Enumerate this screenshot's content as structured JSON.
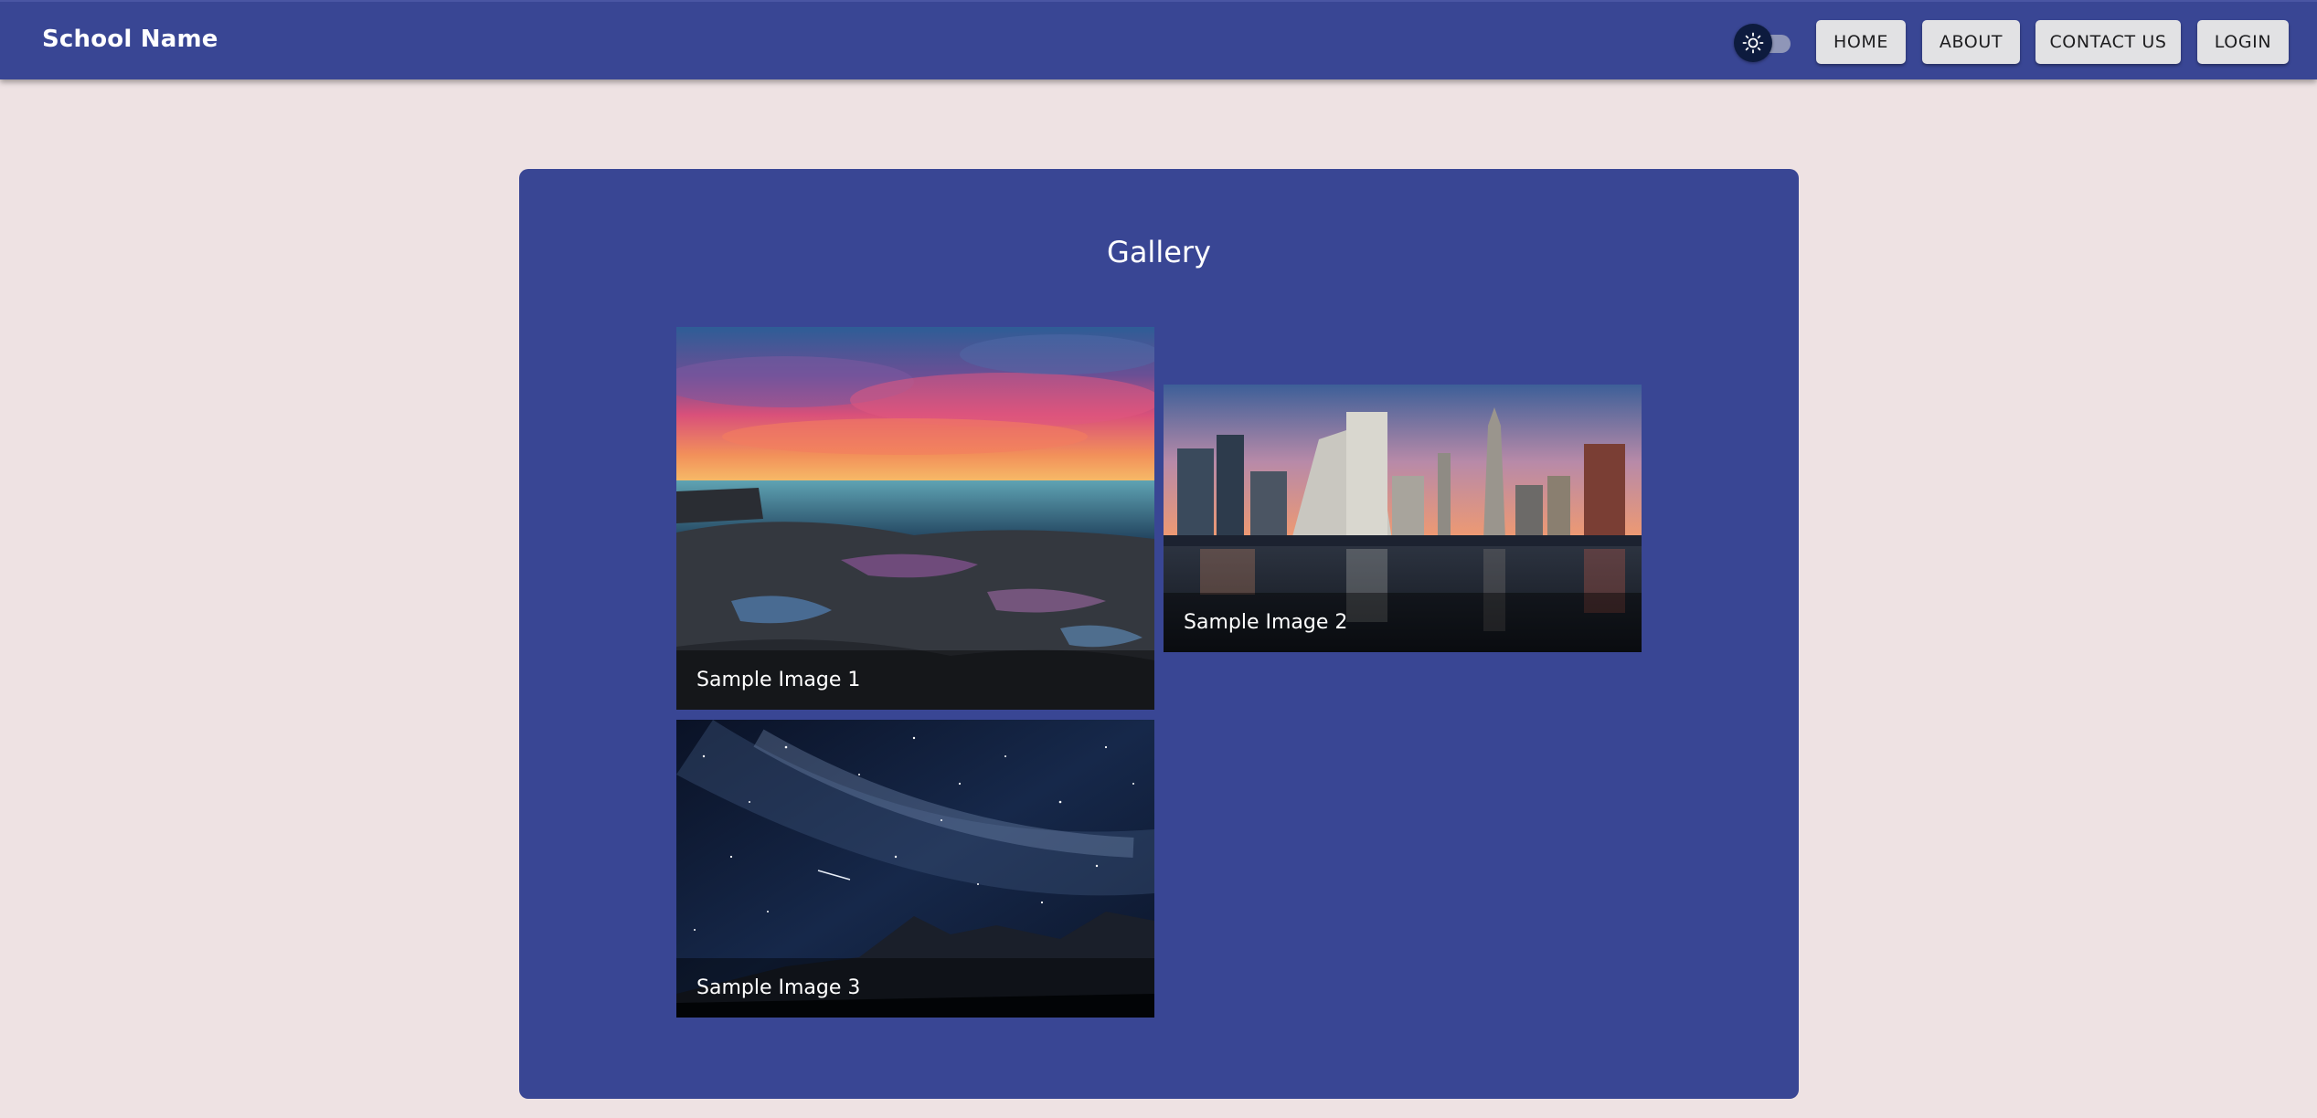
{
  "appbar": {
    "brand": "School Name",
    "theme_toggle_icon": "sun-icon",
    "nav": {
      "home": "HOME",
      "about": "ABOUT",
      "contact": "CONTACT US",
      "login": "LOGIN"
    }
  },
  "gallery": {
    "title": "Gallery",
    "images": [
      {
        "caption": "Sample Image 1"
      },
      {
        "caption": "Sample Image 2"
      },
      {
        "caption": "Sample Image 3"
      }
    ]
  },
  "colors": {
    "primary": "#394694",
    "page_background": "#eee2e3",
    "button_background": "#e2e2e4"
  }
}
